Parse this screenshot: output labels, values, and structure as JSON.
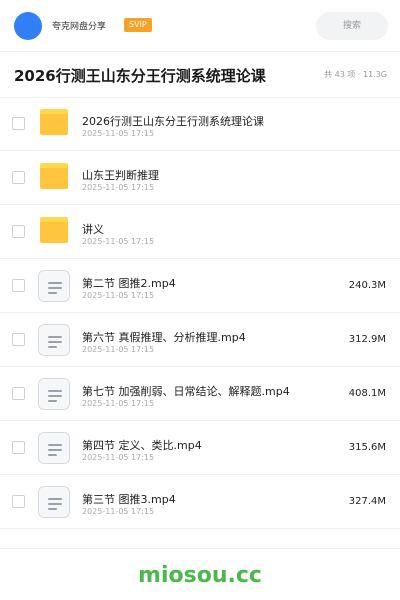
{
  "header": {
    "share_name": "夸克网盘分享",
    "badge": "SVIP",
    "search_placeholder": "搜索"
  },
  "folder": {
    "title": "2026行测王山东分王行测系统理论课",
    "meta": "共 43 项 · 11.3G"
  },
  "items": [
    {
      "type": "folder",
      "name": "2026行测王山东分王行测系统理论课",
      "date": "2025-11-05 17:15",
      "size": ""
    },
    {
      "type": "folder",
      "name": "山东王判断推理",
      "date": "2025-11-05 17:15",
      "size": ""
    },
    {
      "type": "folder",
      "name": "讲义",
      "date": "2025-11-05 17:15",
      "size": ""
    },
    {
      "type": "file",
      "name": "第二节 图推2.mp4",
      "date": "2025-11-05 17:15",
      "size": "240.3M"
    },
    {
      "type": "file",
      "name": "第六节 真假推理、分析推理.mp4",
      "date": "2025-11-05 17:15",
      "size": "312.9M"
    },
    {
      "type": "file",
      "name": "第七节 加强削弱、日常结论、解释题.mp4",
      "date": "2025-11-05 17:15",
      "size": "408.1M"
    },
    {
      "type": "file",
      "name": "第四节 定义、类比.mp4",
      "date": "2025-11-05 17:15",
      "size": "315.6M"
    },
    {
      "type": "file",
      "name": "第三节 图推3.mp4",
      "date": "2025-11-05 17:15",
      "size": "327.4M"
    }
  ],
  "footer": {
    "watermark": "miosou.cc"
  },
  "colors": {
    "accent": "#2f7ff7",
    "badge": "#f7a02a",
    "folder": "#ffc53d",
    "watermark": "#4cb84a"
  }
}
